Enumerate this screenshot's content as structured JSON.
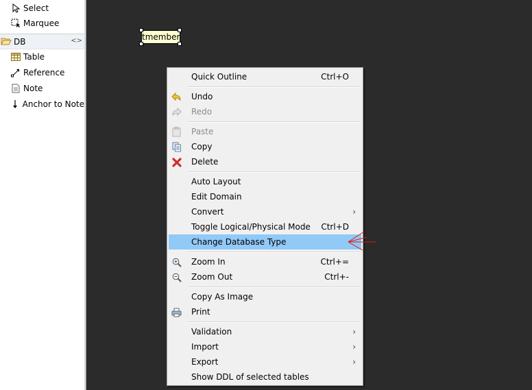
{
  "palette": {
    "tools": [
      {
        "label": "Select",
        "icon": "arrow-cursor-icon"
      },
      {
        "label": "Marquee",
        "icon": "marquee-icon"
      }
    ],
    "drawer": {
      "label": "DB",
      "icon": "open-folder-icon",
      "collapse_icon": "collapse-icon"
    },
    "items": [
      {
        "label": "Table",
        "icon": "table-icon"
      },
      {
        "label": "Reference",
        "icon": "reference-icon"
      },
      {
        "label": "Note",
        "icon": "note-icon"
      },
      {
        "label": "Anchor to Note",
        "icon": "anchor-arrow-icon"
      }
    ]
  },
  "canvas": {
    "table_node": {
      "label": "tmember"
    }
  },
  "context_menu": {
    "items": [
      {
        "label": "Quick Outline",
        "shortcut": "Ctrl+O"
      },
      {
        "label": "Undo",
        "icon": "undo-icon"
      },
      {
        "label": "Redo",
        "icon": "redo-icon",
        "disabled": true
      },
      {
        "label": "Paste",
        "icon": "paste-icon",
        "disabled": true
      },
      {
        "label": "Copy",
        "icon": "copy-icon"
      },
      {
        "label": "Delete",
        "icon": "delete-icon"
      },
      {
        "label": "Auto Layout"
      },
      {
        "label": "Edit Domain"
      },
      {
        "label": "Convert",
        "submenu": true
      },
      {
        "label": "Toggle Logical/Physical Mode",
        "shortcut": "Ctrl+D"
      },
      {
        "label": "Change Database Type",
        "highlighted": true
      },
      {
        "label": "Zoom In",
        "icon": "zoom-in-icon",
        "shortcut": "Ctrl+="
      },
      {
        "label": "Zoom Out",
        "icon": "zoom-out-icon",
        "shortcut": "Ctrl+-"
      },
      {
        "label": "Copy As Image"
      },
      {
        "label": "Print",
        "icon": "print-icon"
      },
      {
        "label": "Validation",
        "submenu": true
      },
      {
        "label": "Import",
        "submenu": true
      },
      {
        "label": "Export",
        "submenu": true
      },
      {
        "label": "Show DDL of selected tables"
      }
    ],
    "submenu_arrow": "›",
    "highlight_color": "#91c9f7"
  },
  "colors": {
    "canvas_bg": "#2b2b2b",
    "menu_bg": "#f0f0f0",
    "node_fill": "#ffffd2",
    "annotation": "#e01818"
  }
}
